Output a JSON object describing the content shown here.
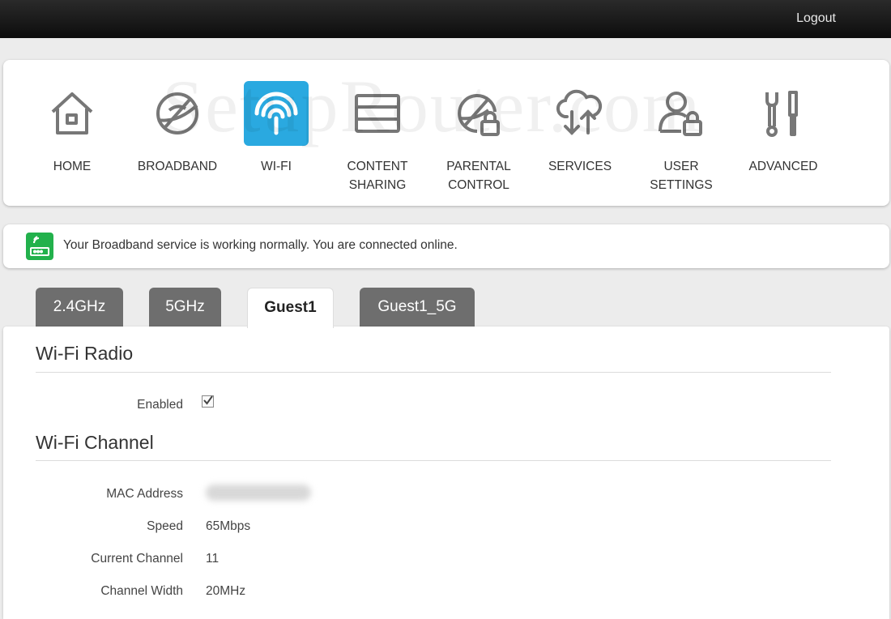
{
  "header": {
    "logout_label": "Logout"
  },
  "watermark": "SetupRouter.com",
  "nav": {
    "items": [
      {
        "label": "HOME",
        "icon": "home-icon"
      },
      {
        "label": "BROADBAND",
        "icon": "globe-icon"
      },
      {
        "label": "WI-FI",
        "icon": "wifi-icon",
        "active": true
      },
      {
        "label": "CONTENT\nSHARING",
        "icon": "storage-icon"
      },
      {
        "label": "PARENTAL\nCONTROL",
        "icon": "globe-lock-icon"
      },
      {
        "label": "SERVICES",
        "icon": "cloud-transfer-icon"
      },
      {
        "label": "USER\nSETTINGS",
        "icon": "user-lock-icon"
      },
      {
        "label": "ADVANCED",
        "icon": "tools-icon"
      }
    ],
    "active_color": "#2aa9e0"
  },
  "status": {
    "message": "Your Broadband service is working normally. You are connected online.",
    "icon": "router-icon",
    "color": "#22b14c"
  },
  "tabs": [
    {
      "label": "2.4GHz"
    },
    {
      "label": "5GHz"
    },
    {
      "label": "Guest1",
      "active": true
    },
    {
      "label": "Guest1_5G"
    }
  ],
  "wifi_radio": {
    "title": "Wi-Fi Radio",
    "enabled_label": "Enabled",
    "enabled": true
  },
  "wifi_channel": {
    "title": "Wi-Fi Channel",
    "fields": [
      {
        "label": "MAC Address",
        "value": ""
      },
      {
        "label": "Speed",
        "value": "65Mbps"
      },
      {
        "label": "Current Channel",
        "value": "11"
      },
      {
        "label": "Channel Width",
        "value": "20MHz"
      }
    ]
  }
}
